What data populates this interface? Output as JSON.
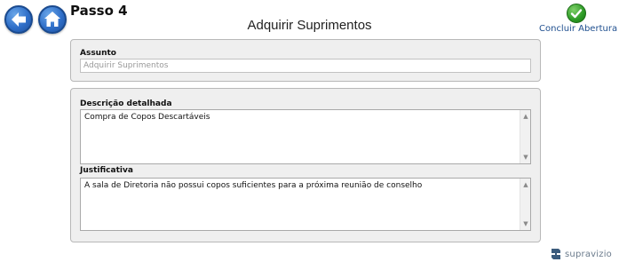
{
  "header": {
    "step_title": "Passo 4",
    "page_title": "Adquirir Suprimentos",
    "conclude_label": "Concluir Abertura",
    "back_icon": "arrow-left-icon",
    "home_icon": "home-icon",
    "conclude_icon": "checkmark-icon"
  },
  "form": {
    "subject_label": "Assunto",
    "subject_value": "Adquirir Suprimentos",
    "description_label": "Descrição detalhada",
    "description_value": "Compra de Copos Descartáveis",
    "justification_label": "Justificativa",
    "justification_value": "A sala de Diretoria não possui copos suficientes para a próxima reunião de conselho"
  },
  "footer": {
    "brand": "supravizio"
  },
  "colors": {
    "nav_blue": "#2f6fc9",
    "success_green": "#2c9a25",
    "link_blue": "#1f4f8f",
    "panel_bg": "#efefef"
  }
}
